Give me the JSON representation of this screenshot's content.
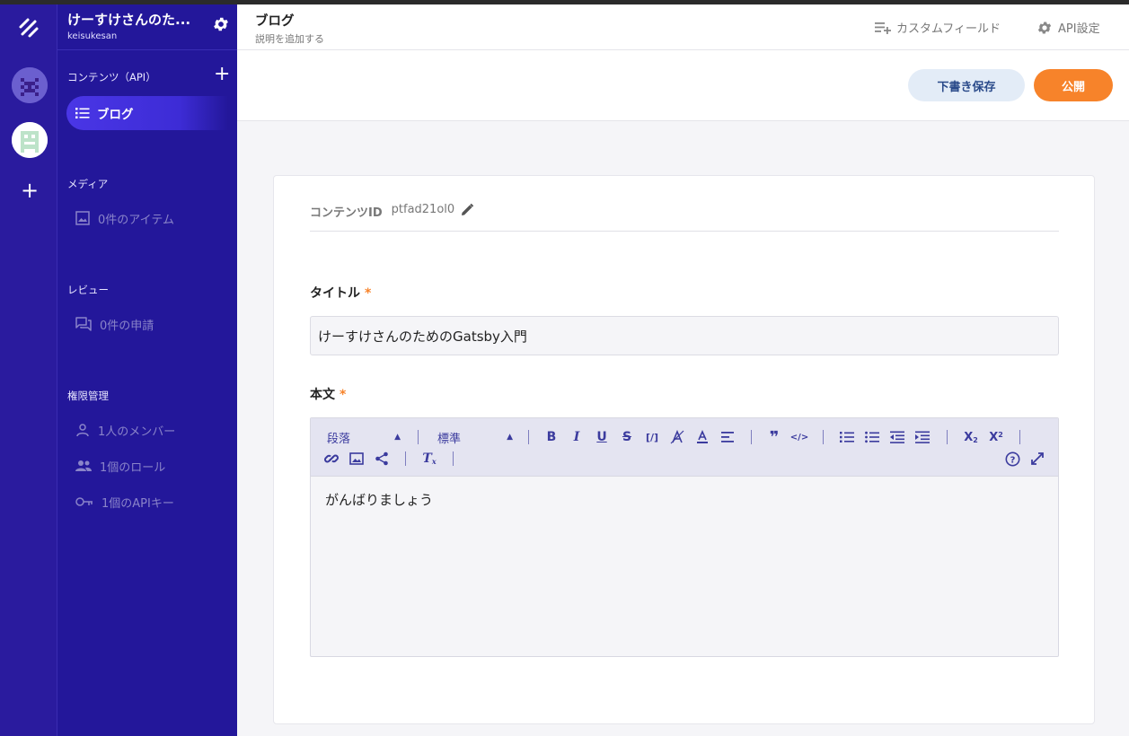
{
  "workspace": {
    "name": "けーすけさんのた...",
    "account": "keisukesan"
  },
  "sidebar": {
    "contents_section": "コンテンツ（API）",
    "active_item": "ブログ",
    "media_section": "メディア",
    "media_item": "0件のアイテム",
    "review_section": "レビュー",
    "review_item": "0件の申請",
    "permission_section": "権限管理",
    "members_item": "1人のメンバー",
    "roles_item": "1個のロール",
    "apikeys_item": "1個のAPIキー"
  },
  "header": {
    "title": "ブログ",
    "description": "説明を追加する",
    "custom_fields": "カスタムフィールド",
    "api_settings": "API設定"
  },
  "actions": {
    "save_draft": "下書き保存",
    "publish": "公開"
  },
  "content": {
    "id_label": "コンテンツID",
    "id_value": "ptfad21ol0",
    "title_label": "タイトル",
    "required_mark": "*",
    "title_value": "けーすけさんのためのGatsby入門",
    "body_label": "本文",
    "body_text": "がんばりましょう"
  },
  "editor_toolbar": {
    "paragraph_select": "段落",
    "size_select": "標準"
  },
  "colors": {
    "sidebar": "#23179a",
    "rail": "#2a1b9e",
    "accent_orange": "#f7832a",
    "toolbar_icon": "#3b3b9e"
  }
}
